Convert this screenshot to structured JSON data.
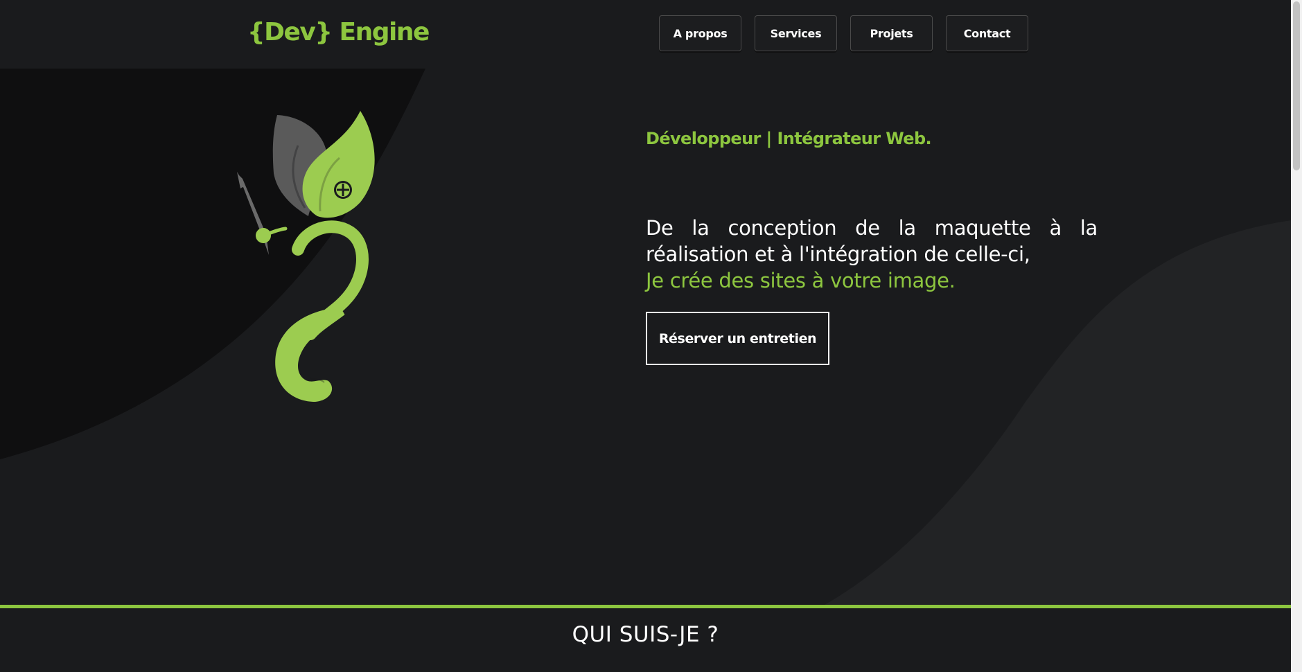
{
  "header": {
    "logo": "{Dev} Engine",
    "nav": [
      "A propos",
      "Services",
      "Projets",
      "Contact"
    ]
  },
  "hero": {
    "tagline": "Développeur | Intégrateur Web.",
    "description": "De la conception de la maquette à la réalisation et à l'intégration de celle-ci,",
    "description_accent": "Je crée des sites à votre image.",
    "cta_label": "Réserver un entretien"
  },
  "about": {
    "title": "QUI SUIS-JE ?"
  },
  "colors": {
    "accent": "#8dc63f",
    "background": "#1a1b1d",
    "dark_blob": "#0f0f10",
    "light_wave": "#222325"
  },
  "icons": [
    "leaf-brush-logo-icon"
  ]
}
